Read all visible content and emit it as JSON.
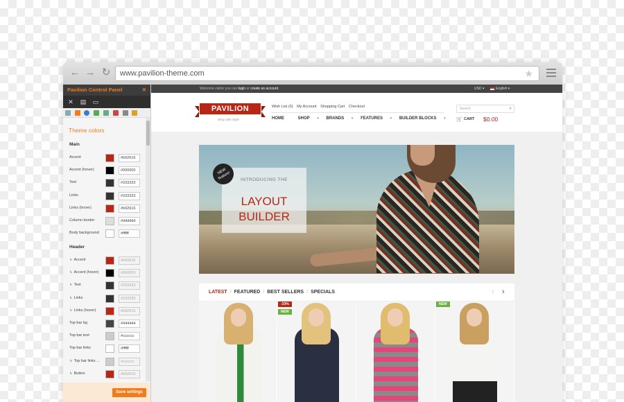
{
  "browser": {
    "url": "www.pavilion-theme.com"
  },
  "panel": {
    "title": "Pavilion Control Panel",
    "close": "✕",
    "section_title": "Theme colors",
    "main_heading": "Main",
    "header_heading": "Header",
    "save_label": "Save settings",
    "main_rows": [
      {
        "label": "Accent",
        "color": "#b92616",
        "value": "#b92616"
      },
      {
        "label": "Accent (hover)",
        "color": "#000000",
        "value": "#000000"
      },
      {
        "label": "Text",
        "color": "#333333",
        "value": "#333333"
      },
      {
        "label": "Links",
        "color": "#333333",
        "value": "#333333"
      },
      {
        "label": "Links (hover)",
        "color": "#b92616",
        "value": "#b92616"
      },
      {
        "label": "Column border",
        "color": "#dddddd",
        "value": "#dddddd"
      },
      {
        "label": "Body background",
        "color": "#ffffff",
        "value": "#ffffff"
      }
    ],
    "header_rows": [
      {
        "label": "Accent",
        "inherit": true,
        "color": "#b92616",
        "value": "#b92616"
      },
      {
        "label": "Accent (hover)",
        "inherit": true,
        "color": "#000000",
        "value": "#000000"
      },
      {
        "label": "Text",
        "inherit": true,
        "color": "#333333",
        "value": "#333333"
      },
      {
        "label": "Links",
        "inherit": true,
        "color": "#333333",
        "value": "#333333"
      },
      {
        "label": "Links (hover)",
        "inherit": true,
        "color": "#b92616",
        "value": "#b92616"
      },
      {
        "label": "Top bar bg",
        "inherit": false,
        "color": "#444444",
        "value": "#444444"
      },
      {
        "label": "Top bar text",
        "inherit": false,
        "color": "#cccccc",
        "value": "#cccccc"
      },
      {
        "label": "Top bar links",
        "inherit": false,
        "color": "#ffffff",
        "value": "#ffffff"
      },
      {
        "label": "Top bar links ...",
        "inherit": true,
        "color": "#cccccc",
        "value": "#cccccc"
      },
      {
        "label": "Button",
        "inherit": true,
        "color": "#b92616",
        "value": "#b92616"
      }
    ]
  },
  "site": {
    "topbar": {
      "welcome_pre": "Welcome visitor you can",
      "login": "login",
      "or": "or",
      "create": "create an account.",
      "currency": "USD ▾",
      "language": "English ▾"
    },
    "logo": "PAVILION",
    "tagline": "Shop with Style",
    "toplinks": [
      "Wish List (0)",
      "My Account",
      "Shopping Cart",
      "Checkout"
    ],
    "nav": [
      {
        "label": "HOME"
      },
      {
        "label": "SHOP"
      },
      {
        "label": "BRANDS"
      },
      {
        "label": "FEATURES"
      },
      {
        "label": "BUILDER BLOCKS"
      }
    ],
    "search_placeholder": "Search",
    "cart_label": "CART",
    "cart_total": "$0.00",
    "banner": {
      "badge_line1": "NEW",
      "badge_line2": "feature!",
      "intro": "INTRODUCING THE",
      "title_line1": "LAYOUT",
      "title_line2": "BUILDER"
    },
    "product_tabs": [
      "LATEST",
      "FEATURED",
      "BEST SELLERS",
      "SPECIALS"
    ],
    "tags": {
      "sale": "-33%",
      "new1": "NEW",
      "new2": "NEW"
    }
  },
  "colors": {
    "accent": "#b92616",
    "orange": "#f07c1a"
  }
}
